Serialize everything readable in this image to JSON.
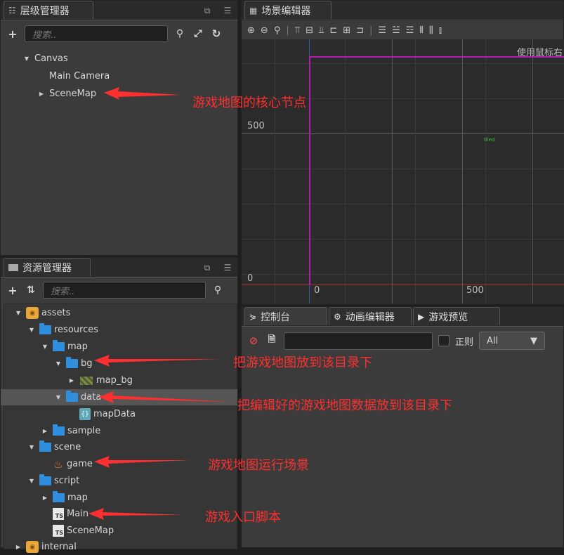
{
  "hierarchy": {
    "tab_label": "层级管理器",
    "search_placeholder": "搜索..",
    "nodes": [
      "Canvas",
      "Main Camera",
      "SceneMap"
    ]
  },
  "scene_editor": {
    "tab_label": "场景编辑器",
    "hint": "使用鼠标右",
    "axis_y_500": "500",
    "axis_y_0": "0",
    "axis_x_0": "0",
    "axis_x_500": "500",
    "small_label": "tiled"
  },
  "assets": {
    "tab_label": "资源管理器",
    "search_placeholder": "搜索..",
    "items": {
      "assets": "assets",
      "resources": "resources",
      "map": "map",
      "bg": "bg",
      "map_bg": "map_bg",
      "data": "data",
      "mapData": "mapData",
      "sample": "sample",
      "scene": "scene",
      "game": "game",
      "script": "script",
      "script_map": "map",
      "main": "Main",
      "scenemap": "SceneMap",
      "internal": "internal"
    }
  },
  "console": {
    "tabs": [
      "控制台",
      "动画编辑器",
      "游戏预览"
    ],
    "regex_label": "正则",
    "filter_value": "All"
  },
  "annotations": {
    "scenemap_note": "游戏地图的核心节点",
    "bg_note": "把游戏地图放到该目录下",
    "data_note": "把编辑好的游戏地图数据放到该目录下",
    "game_note": "游戏地图运行场景",
    "main_note": "游戏入口脚本"
  },
  "colors": {
    "folder": "#2f8fde",
    "annotation": "#ff2f2f",
    "scene_border": "#b01cb0"
  }
}
